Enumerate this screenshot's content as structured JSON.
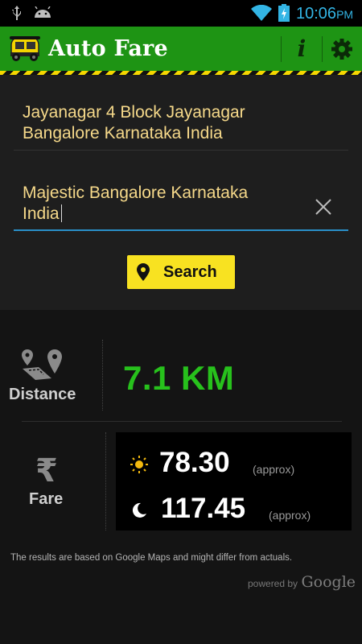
{
  "status_bar": {
    "time": "10:06",
    "ampm": "PM",
    "icons": [
      "usb-icon",
      "android-icon",
      "wifi-icon",
      "battery-charging-icon"
    ]
  },
  "app_bar": {
    "title": "Auto Fare",
    "info_label": "i",
    "brand_color": "#1e9414",
    "icons": [
      "auto-rickshaw-icon",
      "info-icon",
      "gear-icon"
    ]
  },
  "form": {
    "from_value": "Jayanagar 4 Block Jayanagar\nBangalore Karnataka India",
    "to_value": "Majestic Bangalore Karnataka\nIndia",
    "search_label": "Search",
    "text_color": "#f6d98a",
    "button_color": "#f8e221",
    "focus_color": "#2a8fc7"
  },
  "results": {
    "distance_label": "Distance",
    "distance_value": "7.1 KM",
    "distance_color": "#27c11c",
    "fare_label": "Fare",
    "currency_symbol": "₹",
    "day_fare": "78.30",
    "night_fare": "117.45",
    "approx_label": "(approx)",
    "disclaimer": "The results are based on Google Maps and might differ from actuals.",
    "powered_by": "powered by",
    "google": "Google"
  }
}
